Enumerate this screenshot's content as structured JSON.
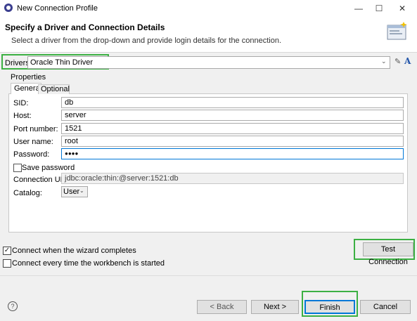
{
  "window": {
    "title": "New Connection Profile",
    "controls": {
      "minimize": "—",
      "maximize": "☐",
      "close": "✕"
    }
  },
  "banner": {
    "title": "Specify a Driver and Connection Details",
    "subtitle": "Select a driver from the drop-down and provide login details for the connection."
  },
  "drivers": {
    "label": "Drivers:",
    "selected": "Oracle Thin Driver"
  },
  "properties": {
    "label": "Properties",
    "tabs": [
      {
        "label": "General",
        "active": true
      },
      {
        "label": "Optional",
        "active": false
      }
    ],
    "fields": [
      {
        "label": "SID:",
        "value": "db"
      },
      {
        "label": "Host:",
        "value": "server"
      },
      {
        "label": "Port number:",
        "value": "1521"
      },
      {
        "label": "User name:",
        "value": "root"
      },
      {
        "label": "Password:",
        "value": "●●●●"
      }
    ],
    "save_password": {
      "label": "Save password",
      "checked": false
    },
    "connection_url": {
      "label": "Connection URL:",
      "value": "jdbc:oracle:thin:@server:1521:db"
    },
    "catalog": {
      "label": "Catalog:",
      "value": "User"
    }
  },
  "options": {
    "connect_when_complete": {
      "label": "Connect when the wizard completes",
      "checked": true
    },
    "connect_every_time": {
      "label": "Connect every time the workbench is started",
      "checked": false
    }
  },
  "buttons": {
    "test_connection": "Test Connection",
    "back": "< Back",
    "next": "Next >",
    "finish": "Finish",
    "cancel": "Cancel",
    "help": "?"
  },
  "highlight_color": "#3cb043"
}
